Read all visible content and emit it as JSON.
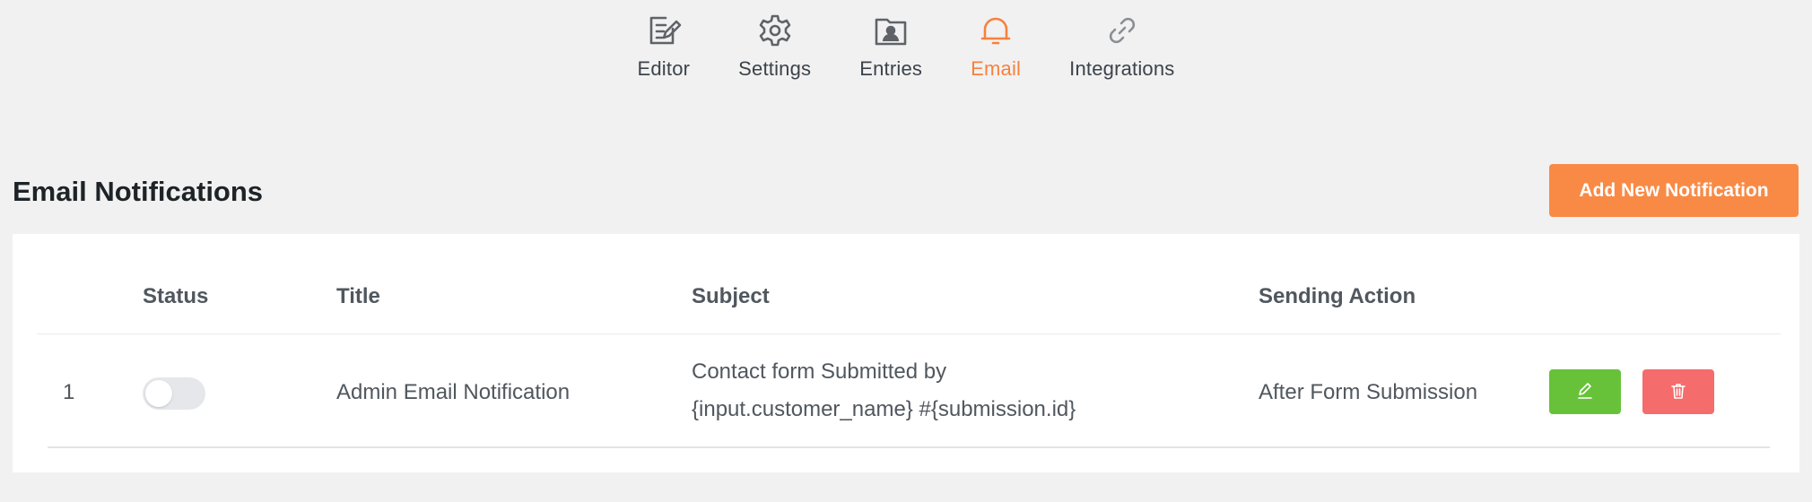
{
  "nav": {
    "items": [
      {
        "label": "Editor",
        "icon": "editor-icon",
        "active": false
      },
      {
        "label": "Settings",
        "icon": "gear-icon",
        "active": false
      },
      {
        "label": "Entries",
        "icon": "entries-icon",
        "active": false
      },
      {
        "label": "Email",
        "icon": "bell-icon",
        "active": true
      },
      {
        "label": "Integrations",
        "icon": "link-icon",
        "active": false
      }
    ],
    "active_color": "#f7813e"
  },
  "section": {
    "title": "Email Notifications",
    "add_button_label": "Add New Notification"
  },
  "table": {
    "columns": [
      "Status",
      "Title",
      "Subject",
      "Sending Action"
    ],
    "rows": [
      {
        "index": "1",
        "status_enabled": false,
        "title": "Admin Email Notification",
        "subject_line1": "Contact form Submitted by",
        "subject_line2": "{input.customer_name} #{submission.id}",
        "sending_action": "After Form Submission"
      }
    ]
  },
  "colors": {
    "accent": "#f98a45",
    "edit": "#67c23a",
    "delete": "#f56c6c"
  }
}
